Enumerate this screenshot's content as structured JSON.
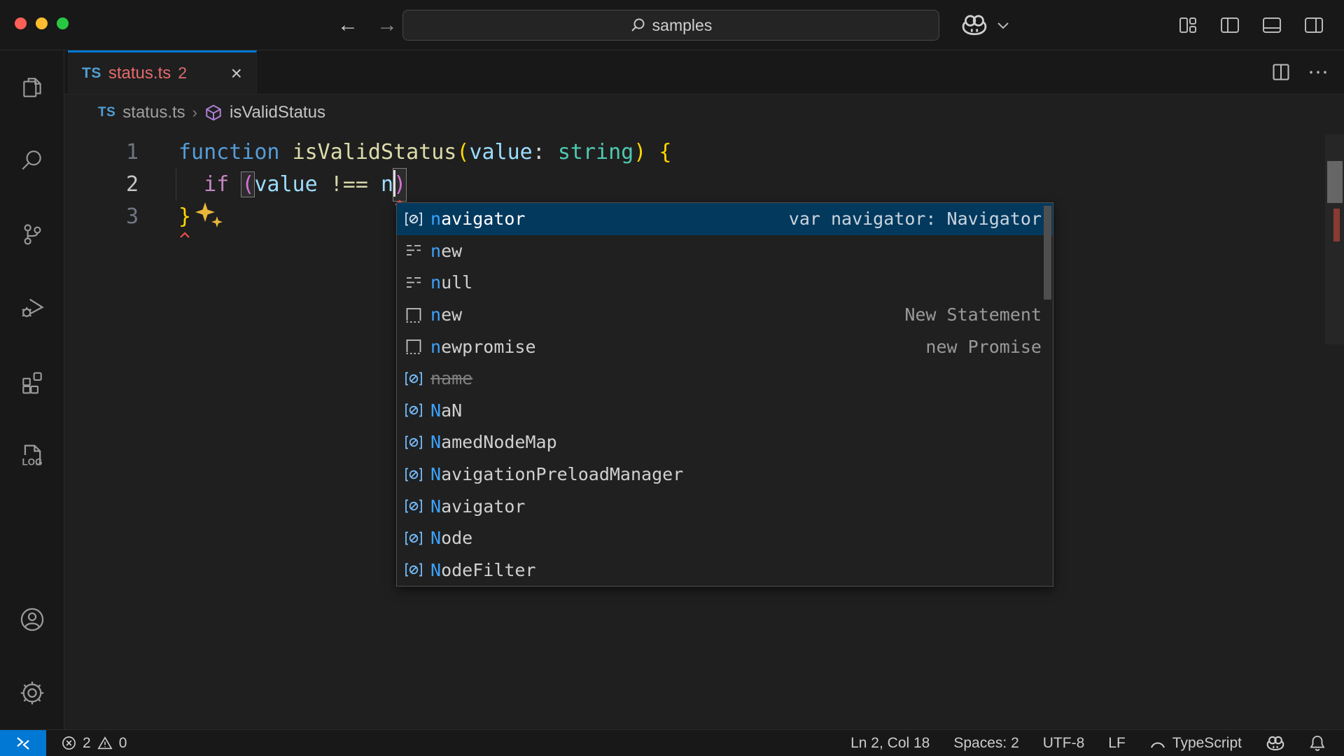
{
  "colors": {
    "accent_blue": "#0078d4",
    "selection_blue": "#04395e",
    "match_blue": "#3ba3ff",
    "error_red": "#f14c4c",
    "tab_error_red": "#e5696b",
    "sparkle_gold": "#eab73b",
    "variable_icon_blue": "#75beff",
    "window_controls": [
      "#ff5f57",
      "#febc2e",
      "#28c840"
    ],
    "syntax": {
      "kw": "#569cd6",
      "fn": "#dcdcaa",
      "var": "#9cdcfe",
      "type": "#4ec9b0",
      "gold": "#ffd700",
      "pink": "#d670d6",
      "ctrl": "#c586c0",
      "op": "#d7d7a8",
      "pl": "#d4d4d4"
    }
  },
  "title_bar": {
    "command_center_text": "samples"
  },
  "activity_bar": {
    "log_label": "LOG"
  },
  "tab": {
    "file_type": "TS",
    "label": "status.ts",
    "error_badge": "2",
    "close_glyph": "×"
  },
  "breadcrumbs": {
    "file_type": "TS",
    "file": "status.ts",
    "separator": "›",
    "symbol": "isValidStatus"
  },
  "editor": {
    "lines": [
      {
        "num": "1",
        "tokens": [
          {
            "t": "function",
            "c": "kw"
          },
          {
            "t": " ",
            "c": "pl"
          },
          {
            "t": "isValidStatus",
            "c": "fn"
          },
          {
            "t": "(",
            "c": "gold"
          },
          {
            "t": "value",
            "c": "var"
          },
          {
            "t": ": ",
            "c": "pl"
          },
          {
            "t": "string",
            "c": "type"
          },
          {
            "t": ")",
            "c": "gold"
          },
          {
            "t": " ",
            "c": "pl"
          },
          {
            "t": "{",
            "c": "gold"
          }
        ]
      },
      {
        "num": "2",
        "active": true,
        "guide": true,
        "tokens": [
          {
            "t": "  ",
            "c": "pl"
          },
          {
            "t": "if",
            "c": "ctrl"
          },
          {
            "t": " ",
            "c": "pl"
          },
          {
            "t": "(",
            "c": "pink",
            "box": true
          },
          {
            "t": "value",
            "c": "var"
          },
          {
            "t": " ",
            "c": "pl"
          },
          {
            "t": "!==",
            "c": "op"
          },
          {
            "t": " ",
            "c": "pl"
          },
          {
            "t": "n",
            "c": "var"
          },
          {
            "cursor": true
          },
          {
            "t": ")",
            "c": "pink",
            "box": true,
            "err": true
          }
        ]
      },
      {
        "num": "3",
        "tokens": [
          {
            "t": "}",
            "c": "gold",
            "err": true
          },
          {
            "sparkle": true
          }
        ]
      }
    ]
  },
  "suggest": {
    "items": [
      {
        "label": "navigator",
        "kind": "variable",
        "detail": "var navigator: Navigator",
        "selected": true
      },
      {
        "label": "new",
        "kind": "keyword"
      },
      {
        "label": "null",
        "kind": "keyword"
      },
      {
        "label": "new",
        "kind": "snippet",
        "detail": "New Statement"
      },
      {
        "label": "newpromise",
        "kind": "snippet",
        "detail": "new Promise"
      },
      {
        "label": "name",
        "kind": "variable",
        "deprecated": true
      },
      {
        "label": "NaN",
        "kind": "variable"
      },
      {
        "label": "NamedNodeMap",
        "kind": "variable"
      },
      {
        "label": "NavigationPreloadManager",
        "kind": "variable"
      },
      {
        "label": "Navigator",
        "kind": "variable"
      },
      {
        "label": "Node",
        "kind": "variable"
      },
      {
        "label": "NodeFilter",
        "kind": "variable"
      }
    ]
  },
  "status_bar": {
    "errors": "2",
    "warnings": "0",
    "line_col": "Ln 2, Col 18",
    "indentation": "Spaces: 2",
    "encoding": "UTF-8",
    "eol": "LF",
    "language": "TypeScript"
  }
}
